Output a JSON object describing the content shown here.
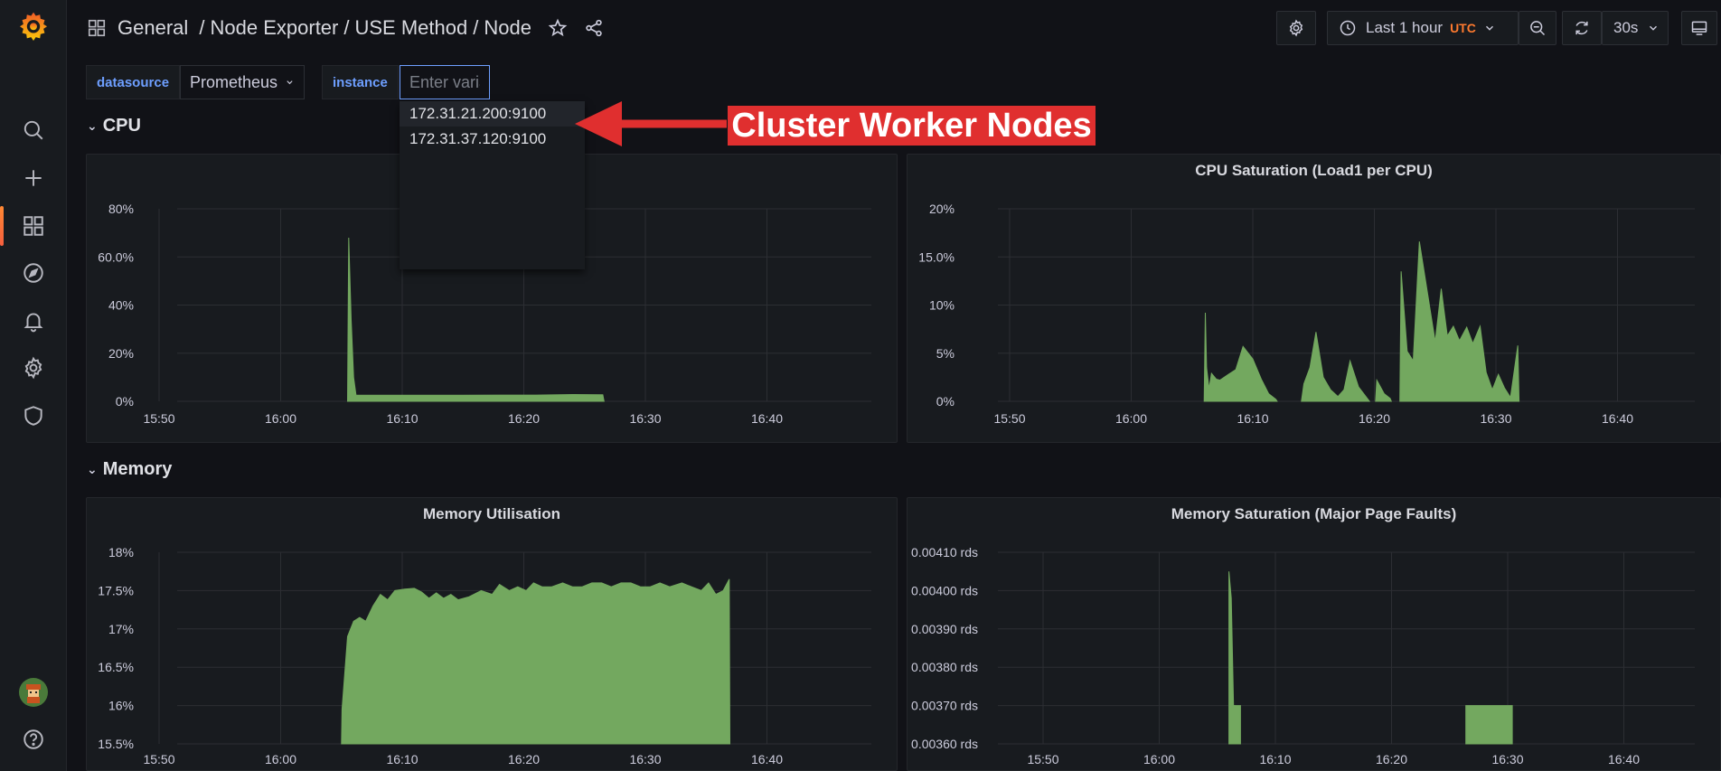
{
  "breadcrumb": {
    "items": [
      "General",
      "Node Exporter",
      "USE Method",
      "Node"
    ]
  },
  "toolbar": {
    "time_range": "Last 1 hour",
    "timezone": "UTC",
    "refresh_interval": "30s"
  },
  "variables": {
    "datasource_label": "datasource",
    "datasource_value": "Prometheus",
    "instance_label": "instance",
    "instance_placeholder": "Enter variable value",
    "instance_options": [
      "172.31.21.200:9100",
      "172.31.37.120:9100"
    ]
  },
  "annotation": {
    "text": "Cluster Worker Nodes",
    "color": "#e02f2f"
  },
  "rows": {
    "cpu": "CPU",
    "memory": "Memory"
  },
  "colors": {
    "series_fill": "#73a85f",
    "accent": "#6e9fff",
    "timezone": "#ff7a2e",
    "brand": "#f46f2e"
  },
  "chart_data": [
    {
      "type": "area",
      "title": "",
      "x": [
        "15:50",
        "16:00",
        "16:10",
        "16:20",
        "16:30",
        "16:40"
      ],
      "y_ticks": [
        "0%",
        "20%",
        "40%",
        "60.0%",
        "80%"
      ],
      "ylim": [
        0,
        80
      ],
      "grid": true,
      "series": [
        {
          "points": [
            [
              15.5,
              0
            ],
            [
              15.6,
              68
            ],
            [
              15.8,
              34
            ],
            [
              16.0,
              10
            ],
            [
              16.2,
              2.5
            ],
            [
              18.0,
              2.5
            ],
            [
              21.0,
              2.5
            ],
            [
              25.0,
              2.5
            ],
            [
              28.0,
              2.6
            ],
            [
              31.0,
              2.6
            ],
            [
              34.0,
              2.8
            ],
            [
              36.5,
              2.7
            ],
            [
              36.6,
              0
            ]
          ]
        }
      ]
    },
    {
      "type": "area",
      "title": "CPU Saturation (Load1 per CPU)",
      "x": [
        "15:50",
        "16:00",
        "16:10",
        "16:20",
        "16:30",
        "16:40"
      ],
      "y_ticks": [
        "0%",
        "5%",
        "10%",
        "15.0%",
        "20%"
      ],
      "ylim": [
        0,
        20
      ],
      "grid": true,
      "series": [
        {
          "segments": [
            [
              [
                16.0,
                0
              ],
              [
                16.1,
                9.2
              ],
              [
                16.2,
                3.5
              ],
              [
                16.4,
                1.3
              ],
              [
                16.6,
                2.9
              ],
              [
                17.0,
                2.3
              ],
              [
                17.3,
                2.2
              ],
              [
                18.0,
                2.8
              ],
              [
                18.6,
                3.3
              ],
              [
                19.2,
                5.7
              ],
              [
                20.0,
                4.4
              ],
              [
                20.7,
                2.3
              ],
              [
                21.3,
                0.8
              ],
              [
                21.9,
                0.2
              ],
              [
                22.0,
                0
              ]
            ],
            [
              [
                24.0,
                0
              ],
              [
                24.2,
                1.8
              ],
              [
                24.7,
                3.5
              ],
              [
                25.2,
                7.2
              ],
              [
                25.8,
                2.5
              ],
              [
                26.4,
                1.2
              ],
              [
                27.0,
                0.5
              ],
              [
                27.5,
                1.2
              ],
              [
                28.0,
                4.2
              ],
              [
                28.7,
                1.5
              ],
              [
                29.3,
                0.5
              ],
              [
                29.6,
                0
              ]
            ],
            [
              [
                30.1,
                0
              ],
              [
                30.2,
                2.2
              ],
              [
                30.8,
                0.8
              ],
              [
                31.3,
                0.3
              ],
              [
                31.4,
                0
              ]
            ],
            [
              [
                32.1,
                0
              ],
              [
                32.2,
                13.5
              ],
              [
                32.7,
                5.2
              ],
              [
                33.2,
                4.2
              ],
              [
                33.7,
                16.6
              ],
              [
                34.4,
                11.0
              ],
              [
                35.0,
                6.2
              ],
              [
                35.5,
                11.7
              ],
              [
                36.0,
                6.8
              ],
              [
                36.5,
                7.8
              ],
              [
                37.0,
                6.3
              ],
              [
                37.6,
                7.7
              ],
              [
                38.1,
                6.0
              ],
              [
                38.7,
                7.8
              ],
              [
                39.2,
                3.0
              ],
              [
                39.7,
                1.2
              ],
              [
                40.2,
                2.8
              ],
              [
                40.7,
                1.4
              ],
              [
                41.2,
                0.4
              ],
              [
                41.8,
                5.8
              ],
              [
                41.9,
                0
              ]
            ]
          ]
        }
      ]
    },
    {
      "type": "area",
      "title": "Memory Utilisation",
      "x": [
        "15:50",
        "16:00",
        "16:10",
        "16:20",
        "16:30",
        "16:40"
      ],
      "y_ticks": [
        "15.5%",
        "16%",
        "16.5%",
        "17%",
        "17.5%",
        "18%"
      ],
      "ylim": [
        15.5,
        18
      ],
      "grid": true,
      "series": [
        {
          "points": [
            [
              15.0,
              15.5
            ],
            [
              15.05,
              15.95
            ],
            [
              15.5,
              16.9
            ],
            [
              16.0,
              17.1
            ],
            [
              16.5,
              17.15
            ],
            [
              17.0,
              17.1
            ],
            [
              17.6,
              17.3
            ],
            [
              18.2,
              17.45
            ],
            [
              18.8,
              17.38
            ],
            [
              19.4,
              17.5
            ],
            [
              20.2,
              17.52
            ],
            [
              21.0,
              17.53
            ],
            [
              21.6,
              17.48
            ],
            [
              22.2,
              17.4
            ],
            [
              22.8,
              17.47
            ],
            [
              23.4,
              17.4
            ],
            [
              24.0,
              17.45
            ],
            [
              24.6,
              17.38
            ],
            [
              25.5,
              17.42
            ],
            [
              26.5,
              17.5
            ],
            [
              27.4,
              17.45
            ],
            [
              28.0,
              17.58
            ],
            [
              28.8,
              17.5
            ],
            [
              29.5,
              17.55
            ],
            [
              30.2,
              17.5
            ],
            [
              30.8,
              17.6
            ],
            [
              31.5,
              17.55
            ],
            [
              32.3,
              17.55
            ],
            [
              33.2,
              17.6
            ],
            [
              34.0,
              17.55
            ],
            [
              34.8,
              17.55
            ],
            [
              35.6,
              17.6
            ],
            [
              36.4,
              17.6
            ],
            [
              37.2,
              17.55
            ],
            [
              38.0,
              17.6
            ],
            [
              38.8,
              17.6
            ],
            [
              39.6,
              17.55
            ],
            [
              40.4,
              17.55
            ],
            [
              41.2,
              17.6
            ],
            [
              42.0,
              17.55
            ],
            [
              43.0,
              17.6
            ],
            [
              43.8,
              17.55
            ],
            [
              44.6,
              17.5
            ],
            [
              45.2,
              17.6
            ],
            [
              45.8,
              17.45
            ],
            [
              46.4,
              17.5
            ],
            [
              46.9,
              17.65
            ],
            [
              46.95,
              15.5
            ]
          ]
        }
      ]
    },
    {
      "type": "area",
      "title": "Memory Saturation (Major Page Faults)",
      "x": [
        "15:50",
        "16:00",
        "16:10",
        "16:20",
        "16:30",
        "16:40"
      ],
      "y_ticks": [
        "0.00360 rds",
        "0.00370 rds",
        "0.00380 rds",
        "0.00390 rds",
        "0.00400 rds",
        "0.00410 rds"
      ],
      "ylim": [
        0.0036,
        0.0041
      ],
      "grid": true,
      "series": [
        {
          "segments": [
            [
              [
                16.0,
                0.0036
              ],
              [
                16.0,
                0.00405
              ],
              [
                16.2,
                0.00398
              ],
              [
                16.4,
                0.0037
              ],
              [
                16.5,
                0.0037
              ],
              [
                16.5,
                0.0036
              ]
            ],
            [
              [
                16.5,
                0.0036
              ],
              [
                16.5,
                0.0037
              ],
              [
                17.0,
                0.0037
              ],
              [
                17.0,
                0.0036
              ]
            ],
            [
              [
                36.4,
                0.0036
              ],
              [
                36.4,
                0.0037
              ],
              [
                40.4,
                0.0037
              ],
              [
                40.4,
                0.0036
              ]
            ]
          ]
        }
      ]
    }
  ]
}
